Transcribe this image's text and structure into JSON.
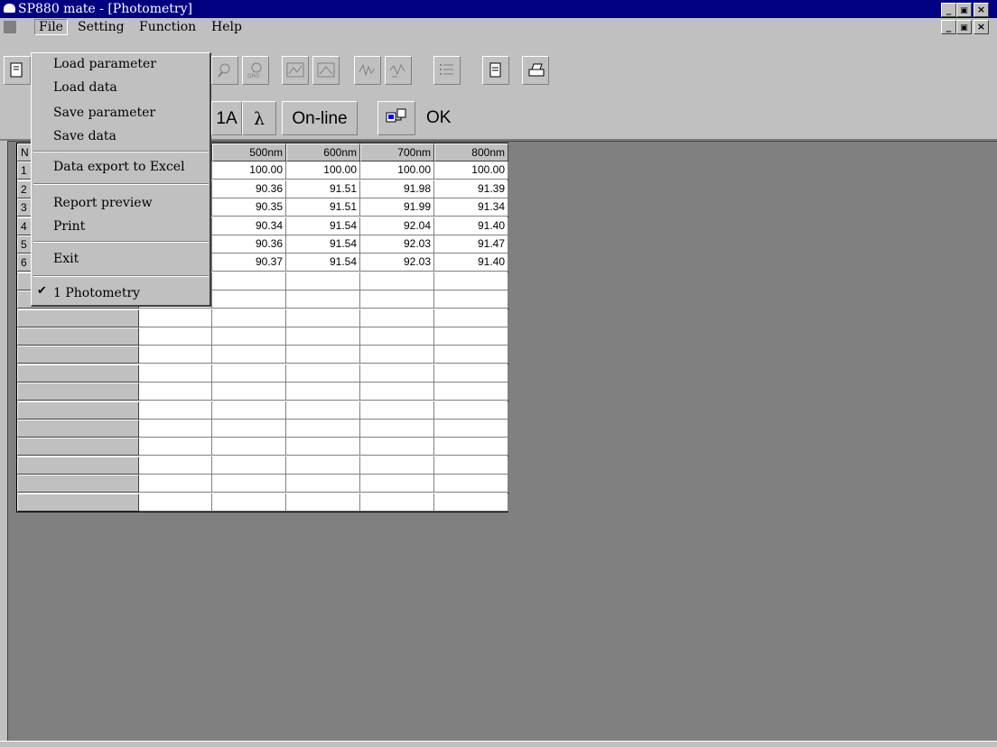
{
  "window": {
    "title": "SP880 mate - [Photometry]",
    "min": "_",
    "restore": "🗗",
    "close": "✕"
  },
  "menubar": {
    "items": [
      "File",
      "Setting",
      "Function",
      "Help"
    ]
  },
  "toolbar2": {
    "cell_label": "1A",
    "lambda_label": "λ",
    "online_label": "On-line",
    "status_label": "OK"
  },
  "file_menu": {
    "items": [
      "Load parameter",
      "Load data",
      "Save parameter",
      "Save data",
      "Data export to Excel",
      "Report preview",
      "Print",
      "Exit",
      "1 Photometry"
    ],
    "checked": "✔"
  },
  "grid": {
    "corner_label": "N",
    "columns": [
      "500nm",
      "600nm",
      "700nm",
      "800nm"
    ],
    "row_labels": [
      "1",
      "2",
      "3",
      "4",
      "5",
      "6"
    ],
    "rows": [
      [
        "100.00",
        "100.00",
        "100.00",
        "100.00"
      ],
      [
        "90.36",
        "91.51",
        "91.98",
        "91.39"
      ],
      [
        "90.35",
        "91.51",
        "91.99",
        "91.34"
      ],
      [
        "90.34",
        "91.54",
        "92.04",
        "91.40"
      ],
      [
        "90.36",
        "91.54",
        "92.03",
        "91.47"
      ],
      [
        "90.37",
        "91.54",
        "92.03",
        "91.40"
      ]
    ]
  }
}
